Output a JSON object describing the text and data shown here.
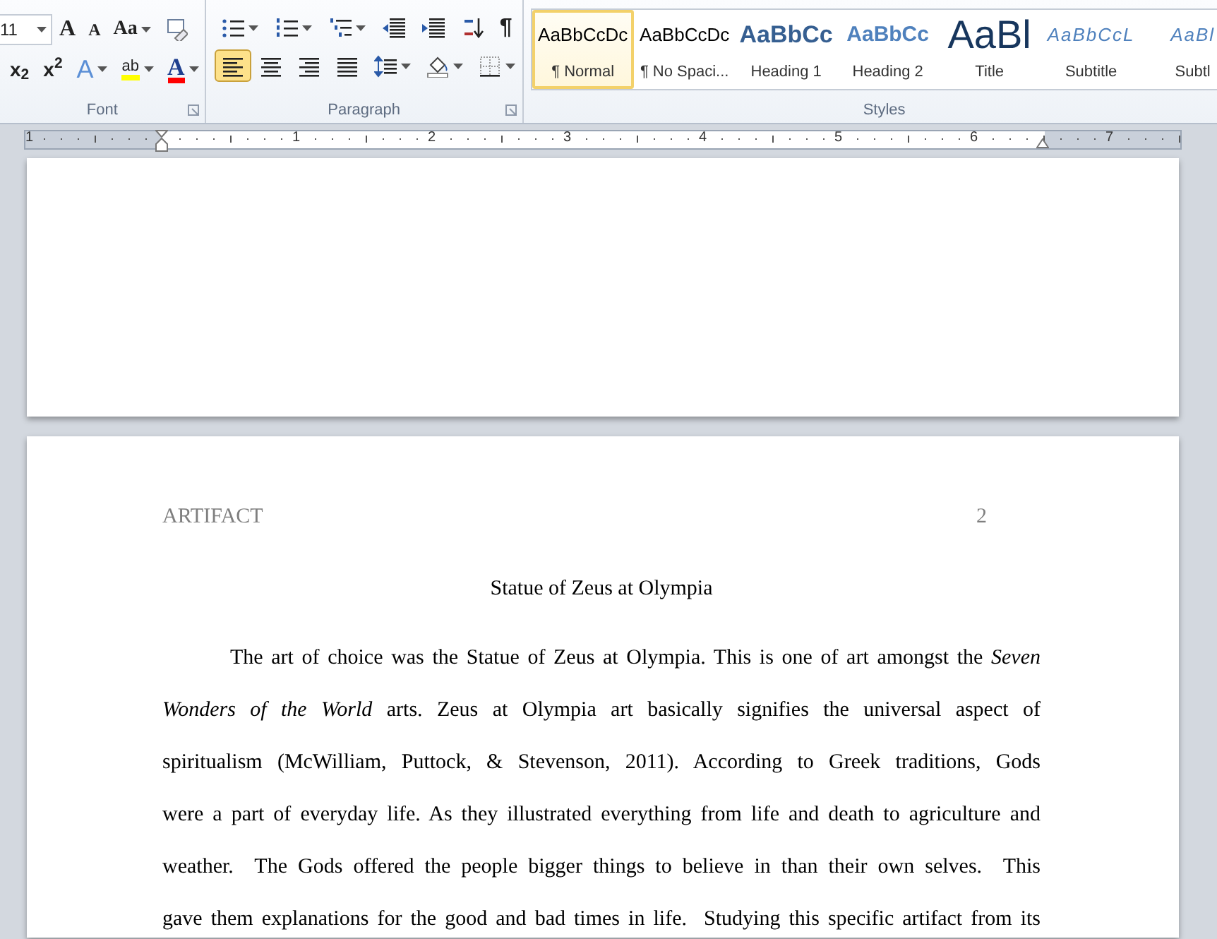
{
  "ribbon": {
    "font_group": {
      "label": "Font",
      "font_size": "11",
      "row1": [
        {
          "kind": "grow",
          "label": "A"
        },
        {
          "kind": "shrink",
          "label": "A"
        },
        {
          "kind": "case",
          "label": "Aa"
        },
        {
          "kind": "clear"
        }
      ],
      "row2": [
        {
          "kind": "subscript",
          "label": "x$_{2}$"
        },
        {
          "kind": "superscript",
          "label": "x$^{2}$"
        },
        {
          "kind": "effects",
          "label": "A"
        },
        {
          "kind": "highlight",
          "label": "ab"
        },
        {
          "kind": "fontcolor",
          "label": "A"
        }
      ]
    },
    "paragraph_group": {
      "label": "Paragraph",
      "row1": [
        {
          "kind": "bullets"
        },
        {
          "kind": "numbering"
        },
        {
          "kind": "multilevel"
        },
        {
          "kind": "outdent"
        },
        {
          "kind": "indent"
        },
        {
          "kind": "sort"
        },
        {
          "kind": "pilcrow",
          "label": "¶"
        }
      ],
      "row2": [
        {
          "kind": "align-left",
          "selected": true
        },
        {
          "kind": "align-center",
          "selected": false
        },
        {
          "kind": "align-right",
          "selected": false
        },
        {
          "kind": "justify",
          "selected": false
        },
        {
          "kind": "spacing"
        },
        {
          "kind": "shading"
        },
        {
          "kind": "borders"
        }
      ]
    },
    "styles_group": {
      "label": "Styles",
      "styles": [
        {
          "kind": "normal",
          "preview": "AaBbCcDc",
          "name": "¶ Normal",
          "selected": true
        },
        {
          "kind": "normal",
          "preview": "AaBbCcDc",
          "name": "¶ No Spaci...",
          "selected": false
        },
        {
          "kind": "heading1",
          "preview": "AaBbCc",
          "name": "Heading 1",
          "selected": false
        },
        {
          "kind": "heading2",
          "preview": "AaBbCc",
          "name": "Heading 2",
          "selected": false
        },
        {
          "kind": "title",
          "preview": "AaBl",
          "name": "Title",
          "selected": false
        },
        {
          "kind": "subtitle",
          "preview": "AaBbCcL",
          "name": "Subtitle",
          "selected": false
        },
        {
          "kind": "subtitle",
          "preview": "AaBl",
          "name": "Subtl",
          "selected": false
        }
      ]
    }
  },
  "ruler": {
    "numbers": [
      "1",
      "1",
      "2",
      "3",
      "4",
      "5",
      "6",
      "7"
    ]
  },
  "page": {
    "header": "ARTIFACT",
    "page_number": "2",
    "title": "Statue of Zeus at Olympia",
    "lines": [
      "The art of choice was the Statue of Zeus at Olympia. This is one of art amongst the *Seven*",
      "*Wonders of the World* arts. Zeus at Olympia art basically signifies the universal aspect of",
      "spiritualism (McWilliam, Puttock, & Stevenson, 2011). According to Greek traditions, Gods",
      "were a part of everyday life. As they illustrated everything from life and death to agriculture and",
      "weather.  The Gods offered the people bigger things to believe in than their own selves.  This",
      "gave them explanations for the good and bad times in life.  Studying this specific artifact from its"
    ]
  }
}
